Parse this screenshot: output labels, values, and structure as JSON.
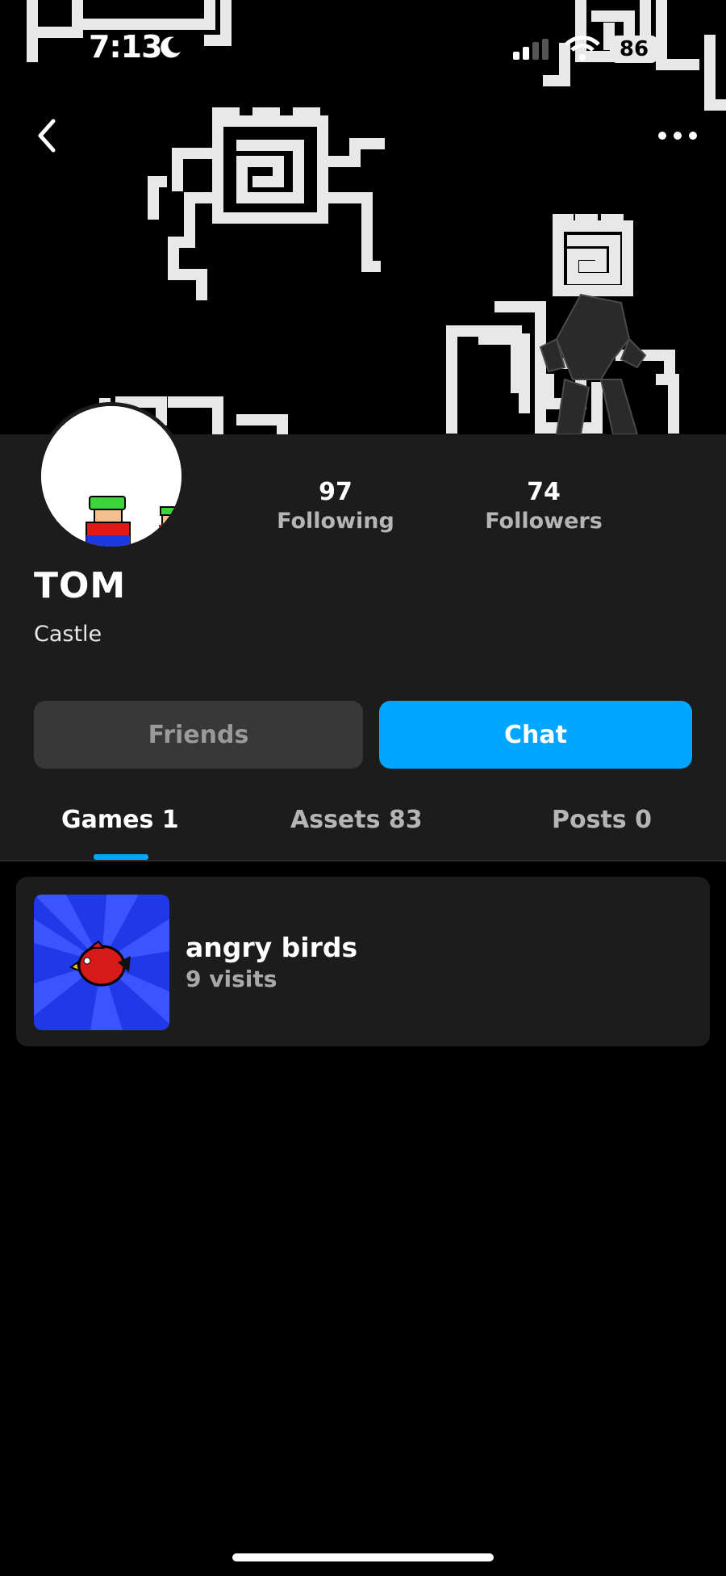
{
  "status_bar": {
    "time": "7:13",
    "battery": "86"
  },
  "header": {
    "back_icon": "chevron-left-icon",
    "more_icon": "ellipsis-icon"
  },
  "profile": {
    "display_name": "TOM",
    "subtitle": "Castle",
    "stats": {
      "following": {
        "value": "97",
        "label": "Following"
      },
      "followers": {
        "value": "74",
        "label": "Followers"
      }
    },
    "actions": {
      "friends_label": "Friends",
      "chat_label": "Chat"
    }
  },
  "tabs": [
    {
      "label": "Games 1",
      "active": true
    },
    {
      "label": "Assets 83",
      "active": false
    },
    {
      "label": "Posts 0",
      "active": false
    }
  ],
  "games": [
    {
      "title": "angry birds",
      "visits": "9 visits"
    }
  ],
  "colors": {
    "accent": "#00a6ff",
    "panel": "#1c1c1c",
    "background": "#000000"
  }
}
